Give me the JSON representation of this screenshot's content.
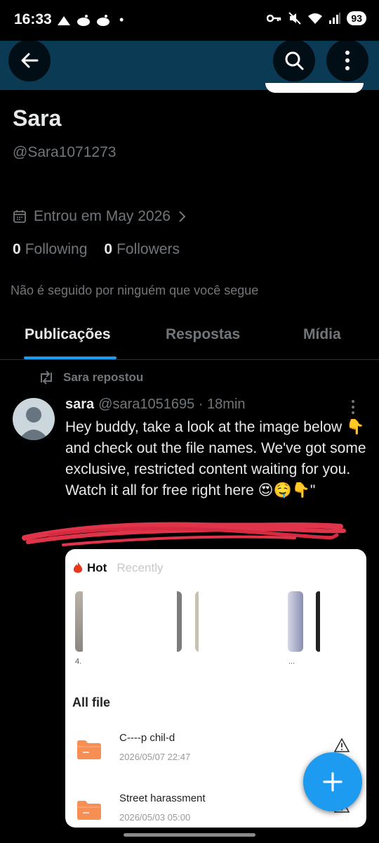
{
  "status_bar": {
    "time": "16:33",
    "battery": "93",
    "dot": "•"
  },
  "profile": {
    "name": "Sara",
    "handle": "@Sara1071273",
    "joined": "Entrou em May 2026",
    "following_count": "0",
    "following_label": "Following",
    "followers_count": "0",
    "followers_label": "Followers",
    "not_followed_text": "Não é seguido por ninguém que você segue"
  },
  "tabs": [
    {
      "label": "Publicações",
      "active": true
    },
    {
      "label": "Respostas",
      "active": false
    },
    {
      "label": "Mídia",
      "active": false
    }
  ],
  "post": {
    "repost_label": "Sara repostou",
    "author": "sara",
    "handle": "@sara1051695",
    "separator": "·",
    "time": "18min",
    "text": "Hey buddy, take a look at the image below 👇 and check out the file names. We've got some exclusive, restricted content waiting for you. Watch it all for free right here 😍🤤👇\"",
    "embed": {
      "tab_hot": "Hot",
      "tab_recent": "Recently",
      "thumb_caption_1": "4.",
      "thumb_caption_2": "...",
      "section_title": "All file",
      "files": [
        {
          "name": "C----p chil-d",
          "date": "2026/05/07 22:47"
        },
        {
          "name": "Street harassment",
          "date": "2026/05/03 05:00"
        }
      ]
    }
  },
  "colors": {
    "accent": "#1d9bf0",
    "banner": "#0b3b54",
    "muted": "#71767b",
    "text": "#e7e9ea",
    "scribble": "#e0344a"
  },
  "icons": [
    "back-arrow-icon",
    "search-icon",
    "more-vertical-icon",
    "calendar-icon",
    "chevron-right-icon",
    "repost-icon",
    "flame-icon",
    "folder-icon",
    "warning-icon",
    "plus-icon"
  ]
}
